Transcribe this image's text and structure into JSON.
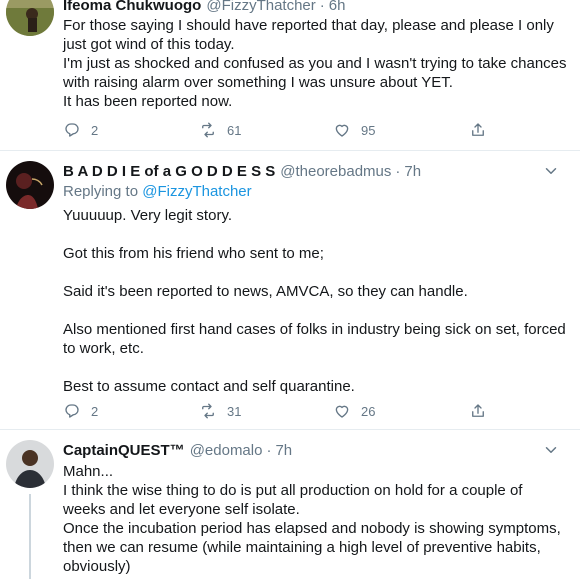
{
  "tweets": [
    {
      "name": "Ifeoma Chukwuogo",
      "handle": "@FizzyThatcher",
      "time": "6h",
      "lines": [
        "For those saying I should have reported that day, please and please I only",
        "just got wind of this today.",
        "I'm just as shocked and confused as you and I wasn't trying to take chances",
        "with raising alarm over something I was unsure about YET.",
        "It has been reported now."
      ],
      "replies": "2",
      "retweets": "61",
      "likes": "95"
    },
    {
      "name": "B A D D I E of a G O D D E S S",
      "handle": "@theorebadmus",
      "time": "7h",
      "replying_label": "Replying to",
      "replying_to": "@FizzyThatcher",
      "lines": [
        "Yuuuuup. Very legit story.",
        "",
        "Got this from his friend who sent to me;",
        "",
        "Said it's been reported to news, AMVCA, so they can handle.",
        "",
        "Also mentioned first hand cases of folks in industry being sick on set, forced",
        "to work, etc.",
        "",
        "Best to assume contact and self quarantine."
      ],
      "replies": "2",
      "retweets": "31",
      "likes": "26"
    },
    {
      "name": "CaptainQUEST™",
      "handle": "@edomalo",
      "time": "7h",
      "lines": [
        "Mahn...",
        "I think the wise thing to do is put all production on hold for a couple of",
        "weeks and let everyone self isolate.",
        "Once the incubation period has elapsed and nobody is showing symptoms,",
        "then we can resume (while maintaining a high level of preventive habits,",
        "obviously)"
      ]
    }
  ],
  "icons": [
    "reply-icon",
    "retweet-icon",
    "like-icon",
    "share-icon",
    "chevron-down-icon"
  ],
  "colors": {
    "text": "#14171a",
    "secondary": "#657786",
    "link": "#1b95e0",
    "divider": "#e6ecf0"
  }
}
